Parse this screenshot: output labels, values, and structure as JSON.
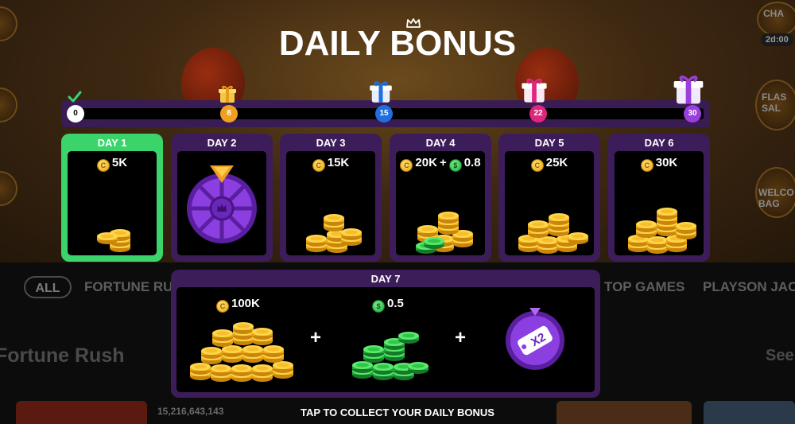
{
  "title": "DAILY BONUS",
  "progress": {
    "milestones": [
      {
        "label": "0",
        "color": "#ffffff",
        "gift": "check-icon"
      },
      {
        "label": "8",
        "color": "#f0a020",
        "gift": "gift-gold-icon"
      },
      {
        "label": "15",
        "color": "#1e6fe0",
        "gift": "gift-blue-icon"
      },
      {
        "label": "22",
        "color": "#e0257e",
        "gift": "gift-pink-icon"
      },
      {
        "label": "30",
        "color": "#9b3ee0",
        "gift": "gift-purple-icon"
      }
    ]
  },
  "days": [
    {
      "label": "DAY 1",
      "coins": "5K",
      "active": true
    },
    {
      "label": "DAY 2",
      "reward": "wheel-icon"
    },
    {
      "label": "DAY 3",
      "coins": "15K"
    },
    {
      "label": "DAY 4",
      "coins": "20K",
      "plus": "+",
      "cash": "0.8"
    },
    {
      "label": "DAY 5",
      "coins": "25K"
    },
    {
      "label": "DAY 6",
      "coins": "30K"
    }
  ],
  "day7": {
    "label": "DAY 7",
    "coins": "100K",
    "cash": "0.5",
    "plus": "+",
    "multiplier": "X2"
  },
  "footer": "TAP TO COLLECT YOUR DAILY BONUS",
  "background": {
    "chip_all": "ALL",
    "categories": [
      "FORTUNE RU",
      "TOP GAMES",
      "PLAYSON JAC"
    ],
    "section": "Fortune Rush",
    "see": "See",
    "jackpot": "15,216,643,143",
    "side_labels": [
      "CHA",
      "FLAS SAL",
      "WELCO BAG"
    ],
    "timer": "2d:00"
  },
  "colors": {
    "panel": "#3d1c5a",
    "active": "#3ad46a",
    "coin": "#f5b81c",
    "cash": "#2ec74a"
  }
}
